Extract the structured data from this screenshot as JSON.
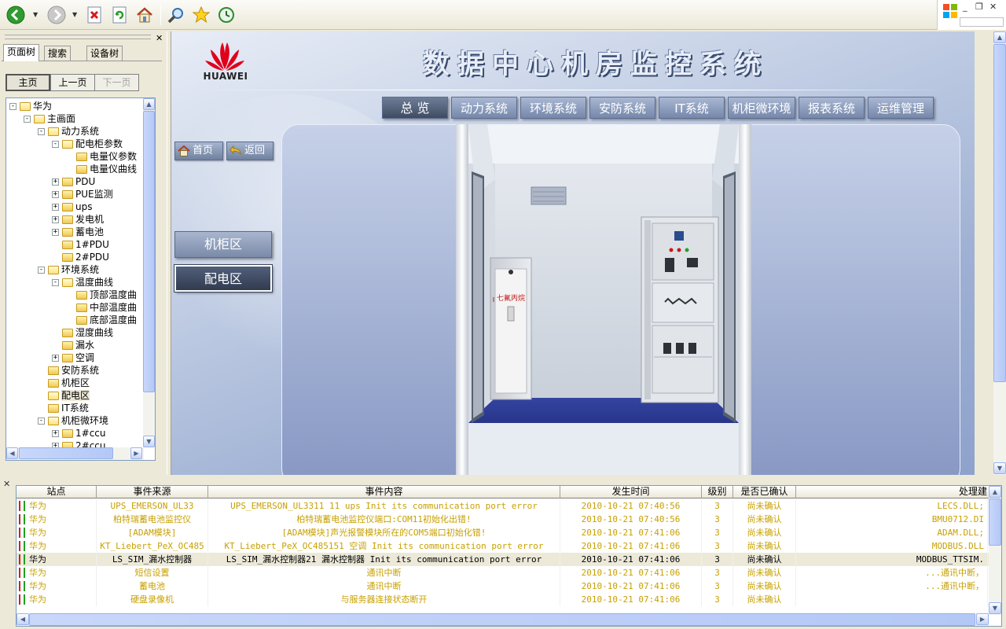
{
  "toolbar": {
    "buttons": [
      "back-icon",
      "forward-icon",
      "stop-icon",
      "refresh-icon",
      "home-icon",
      "search-icon",
      "favorites-icon",
      "history-icon"
    ]
  },
  "left_pane": {
    "tabs": [
      "页面树",
      "搜索",
      "设备树"
    ],
    "nav": {
      "home": "主页",
      "prev": "上一页",
      "next": "下一页"
    },
    "tree": [
      {
        "label": "华为",
        "level": 0,
        "pm": "-",
        "kind": "root"
      },
      {
        "label": "主画面",
        "level": 1,
        "pm": "-",
        "kind": "open"
      },
      {
        "label": "动力系统",
        "level": 2,
        "pm": "-",
        "kind": "open"
      },
      {
        "label": "配电柜参数",
        "level": 3,
        "pm": "-",
        "kind": "open"
      },
      {
        "label": "电量仪参数",
        "level": 4,
        "pm": "",
        "kind": "leaf"
      },
      {
        "label": "电量仪曲线",
        "level": 4,
        "pm": "",
        "kind": "leaf"
      },
      {
        "label": "PDU",
        "level": 3,
        "pm": "+",
        "kind": "closed"
      },
      {
        "label": "PUE监测",
        "level": 3,
        "pm": "+",
        "kind": "closed"
      },
      {
        "label": "ups",
        "level": 3,
        "pm": "+",
        "kind": "closed"
      },
      {
        "label": "发电机",
        "level": 3,
        "pm": "+",
        "kind": "closed"
      },
      {
        "label": "蓄电池",
        "level": 3,
        "pm": "+",
        "kind": "closed"
      },
      {
        "label": "1#PDU",
        "level": 3,
        "pm": "",
        "kind": "leaf"
      },
      {
        "label": "2#PDU",
        "level": 3,
        "pm": "",
        "kind": "leaf"
      },
      {
        "label": "环境系统",
        "level": 2,
        "pm": "-",
        "kind": "open"
      },
      {
        "label": "温度曲线",
        "level": 3,
        "pm": "-",
        "kind": "open"
      },
      {
        "label": "顶部温度曲",
        "level": 4,
        "pm": "",
        "kind": "leaf"
      },
      {
        "label": "中部温度曲",
        "level": 4,
        "pm": "",
        "kind": "leaf"
      },
      {
        "label": "底部温度曲",
        "level": 4,
        "pm": "",
        "kind": "leaf"
      },
      {
        "label": "湿度曲线",
        "level": 3,
        "pm": "",
        "kind": "leaf"
      },
      {
        "label": "漏水",
        "level": 3,
        "pm": "",
        "kind": "leaf"
      },
      {
        "label": "空调",
        "level": 3,
        "pm": "+",
        "kind": "closed"
      },
      {
        "label": "安防系统",
        "level": 2,
        "pm": "",
        "kind": "leaf"
      },
      {
        "label": "机柜区",
        "level": 2,
        "pm": "",
        "kind": "leaf"
      },
      {
        "label": "配电区",
        "level": 2,
        "pm": "",
        "kind": "open",
        "selected": true
      },
      {
        "label": "IT系统",
        "level": 2,
        "pm": "",
        "kind": "leaf"
      },
      {
        "label": "机柜微环境",
        "level": 2,
        "pm": "-",
        "kind": "open"
      },
      {
        "label": "1#ccu",
        "level": 3,
        "pm": "+",
        "kind": "closed"
      },
      {
        "label": "2#ccu",
        "level": 3,
        "pm": "+",
        "kind": "closed"
      }
    ]
  },
  "main": {
    "brand": "HUAWEI",
    "title": "数据中心机房监控系统",
    "tabs": [
      "总 览",
      "动力系统",
      "环境系统",
      "安防系统",
      "IT系统",
      "机柜微环境",
      "报表系统",
      "运维管理"
    ],
    "active_tab": 0,
    "home_btn": "首页",
    "back_btn": "返回",
    "zones": [
      "机柜区",
      "配电区"
    ],
    "active_zone": 1,
    "cabinet_label": "七氟丙烷"
  },
  "events": {
    "columns": [
      "站点",
      "事件来源",
      "事件内容",
      "发生时间",
      "级别",
      "是否已确认",
      "处理建"
    ],
    "rows": [
      {
        "site": "华为",
        "source": "UPS_EMERSON_UL33",
        "content": "UPS_EMERSON_UL3311 11 ups Init its communication port error",
        "time": "2010-10-21 07:40:56",
        "level": "3",
        "ack": "尚未确认",
        "handle": "LECS.DLL;"
      },
      {
        "site": "华为",
        "source": "柏特瑞蓄电池监控仪",
        "content": "柏特瑞蓄电池监控仪端口:COM11初始化出错!",
        "time": "2010-10-21 07:40:56",
        "level": "3",
        "ack": "尚未确认",
        "handle": "BMU0712.DI"
      },
      {
        "site": "华为",
        "source": "[ADAM模块]",
        "content": "[ADAM模块]声光报警模块所在的COM5端口初始化错!",
        "time": "2010-10-21 07:41:06",
        "level": "3",
        "ack": "尚未确认",
        "handle": "ADAM.DLL;"
      },
      {
        "site": "华为",
        "source": "KT_Liebert_PeX_OC485",
        "content": "KT_Liebert_PeX_OC485151 空调 Init its communication port error",
        "time": "2010-10-21 07:41:06",
        "level": "3",
        "ack": "尚未确认",
        "handle": "MODBUS.DLL"
      },
      {
        "site": "华为",
        "source": "LS_SIM_漏水控制器",
        "content": "LS_SIM_漏水控制器21 漏水控制器 Init its communication port error",
        "time": "2010-10-21 07:41:06",
        "level": "3",
        "ack": "尚未确认",
        "handle": "MODBUS_TTSIM.",
        "selected": true
      },
      {
        "site": "华为",
        "source": "短信设置",
        "content": "通讯中断",
        "time": "2010-10-21 07:41:06",
        "level": "3",
        "ack": "尚未确认",
        "handle": "...通讯中断，"
      },
      {
        "site": "华为",
        "source": "蓄电池",
        "content": "通讯中断",
        "time": "2010-10-21 07:41:06",
        "level": "3",
        "ack": "尚未确认",
        "handle": "...通讯中断，"
      },
      {
        "site": "华为",
        "source": "硬盘录像机",
        "content": "与服务器连接状态断开",
        "time": "2010-10-21 07:41:06",
        "level": "3",
        "ack": "尚未确认",
        "handle": ""
      }
    ]
  },
  "colors": {
    "alarm_text": "#c8a000",
    "huawei_red": "#e0001b",
    "active_tab": "#3e4b62"
  }
}
